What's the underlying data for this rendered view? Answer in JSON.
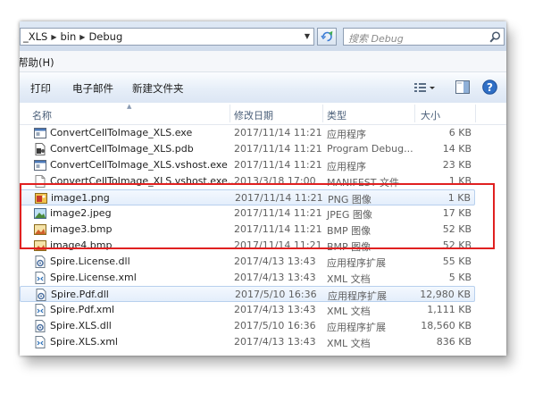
{
  "address": {
    "segments": [
      "_XLS",
      "bin",
      "Debug"
    ],
    "search_placeholder": "搜索 Debug"
  },
  "menu": {
    "help": "帮助(H)"
  },
  "toolbar": {
    "print": "打印",
    "email": "电子邮件",
    "new_folder": "新建文件夹"
  },
  "columns": {
    "name": "名称",
    "date": "修改日期",
    "type": "类型",
    "size": "大小"
  },
  "files": [
    {
      "name": "ConvertCellToImage_XLS.exe",
      "date": "2017/11/14 11:21",
      "type": "应用程序",
      "size": "6 KB",
      "icon": "exe-icon"
    },
    {
      "name": "ConvertCellToImage_XLS.pdb",
      "date": "2017/11/14 11:21",
      "type": "Program Debug...",
      "size": "14 KB",
      "icon": "pdb-icon"
    },
    {
      "name": "ConvertCellToImage_XLS.vshost.exe",
      "date": "2017/11/14 11:21",
      "type": "应用程序",
      "size": "23 KB",
      "icon": "exe-icon"
    },
    {
      "name": "ConvertCellToImage_XLS.vshost.exe....",
      "date": "2013/3/18 17:00",
      "type": "MANIFEST 文件",
      "size": "1 KB",
      "icon": "manifest-icon"
    },
    {
      "name": "image1.png",
      "date": "2017/11/14 11:21",
      "type": "PNG 图像",
      "size": "1 KB",
      "icon": "png-icon",
      "selected": true
    },
    {
      "name": "image2.jpeg",
      "date": "2017/11/14 11:21",
      "type": "JPEG 图像",
      "size": "17 KB",
      "icon": "jpeg-icon"
    },
    {
      "name": "image3.bmp",
      "date": "2017/11/14 11:21",
      "type": "BMP 图像",
      "size": "52 KB",
      "icon": "bmp-icon"
    },
    {
      "name": "image4.bmp",
      "date": "2017/11/14 11:21",
      "type": "BMP 图像",
      "size": "52 KB",
      "icon": "bmp-icon"
    },
    {
      "name": "Spire.License.dll",
      "date": "2017/4/13 13:43",
      "type": "应用程序扩展",
      "size": "55 KB",
      "icon": "dll-icon"
    },
    {
      "name": "Spire.License.xml",
      "date": "2017/4/13 13:43",
      "type": "XML 文档",
      "size": "5 KB",
      "icon": "xml-icon"
    },
    {
      "name": "Spire.Pdf.dll",
      "date": "2017/5/10 16:36",
      "type": "应用程序扩展",
      "size": "12,980 KB",
      "icon": "dll-icon",
      "selected": true
    },
    {
      "name": "Spire.Pdf.xml",
      "date": "2017/4/13 13:43",
      "type": "XML 文档",
      "size": "1,111 KB",
      "icon": "xml-icon"
    },
    {
      "name": "Spire.XLS.dll",
      "date": "2017/5/10 16:36",
      "type": "应用程序扩展",
      "size": "18,560 KB",
      "icon": "dll-icon"
    },
    {
      "name": "Spire.XLS.xml",
      "date": "2017/4/13 13:43",
      "type": "XML 文档",
      "size": "836 KB",
      "icon": "xml-icon"
    }
  ],
  "colors": {
    "highlight_box": "#e02020",
    "selection_border": "#b8d0ee"
  }
}
